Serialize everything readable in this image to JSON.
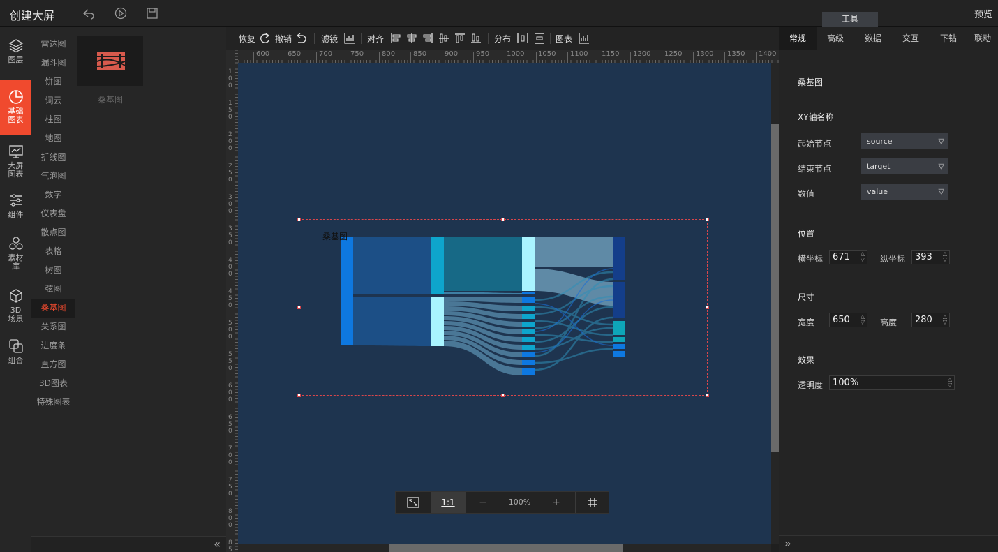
{
  "app": {
    "title": "创建大屏",
    "tools_tab": "工具",
    "preview": "预览",
    "top_icons": [
      "undo-arrow-icon",
      "play-icon",
      "save-icon"
    ]
  },
  "left_nav": [
    {
      "label": "图层",
      "icon": "layers-icon"
    },
    {
      "label": "基础图表",
      "icon": "pie-clock-icon",
      "active": true
    },
    {
      "label": "大屏图表",
      "icon": "screen-chart-icon"
    },
    {
      "label": "组件",
      "icon": "sliders-icon"
    },
    {
      "label": "素材库",
      "icon": "hexagons-icon"
    },
    {
      "label": "3D场景",
      "icon": "cube-icon"
    },
    {
      "label": "组合",
      "icon": "group-icon"
    }
  ],
  "chart_categories": [
    "雷达图",
    "漏斗图",
    "饼图",
    "词云",
    "柱图",
    "地图",
    "折线图",
    "气泡图",
    "数字",
    "仪表盘",
    "散点图",
    "表格",
    "树图",
    "弦图",
    "桑基图",
    "关系图",
    "进度条",
    "直方图",
    "3D图表",
    "特殊图表"
  ],
  "active_category": "桑基图",
  "thumbnail": {
    "label": "桑基图"
  },
  "toolbar": {
    "redo": "恢复",
    "undo": "撤销",
    "filter": "滤镜",
    "align": "对齐",
    "distribute": "分布",
    "chart": "图表"
  },
  "ruler_h": [
    "600",
    "650",
    "700",
    "750",
    "800",
    "850",
    "900",
    "950",
    "1000",
    "1050",
    "1100",
    "1150",
    "1200",
    "1250",
    "1300",
    "1350",
    "1400"
  ],
  "ruler_v": [
    "100",
    "150",
    "200",
    "250",
    "300",
    "350",
    "400",
    "450",
    "500",
    "550",
    "600",
    "650",
    "700",
    "750",
    "800",
    "850",
    "900"
  ],
  "widget": {
    "title": "桑基图"
  },
  "zoom": {
    "fit_icon": "fit-screen-icon",
    "ratio": "1:1",
    "minus": "−",
    "level": "100%",
    "plus": "+",
    "grid_icon": "grid-icon"
  },
  "right_panel": {
    "tabs": [
      "常规",
      "高级",
      "数据",
      "交互",
      "下钻",
      "联动"
    ],
    "active_tab": "常规",
    "chart_name": "桑基图",
    "xy_section": "XY轴名称",
    "fields": [
      {
        "label": "起始节点",
        "value": "source"
      },
      {
        "label": "结束节点",
        "value": "target"
      },
      {
        "label": "数值",
        "value": "value"
      }
    ],
    "position_section": "位置",
    "x_label": "横坐标",
    "x_value": "671",
    "y_label": "纵坐标",
    "y_value": "393",
    "size_section": "尺寸",
    "w_label": "宽度",
    "w_value": "650",
    "h_label": "高度",
    "h_value": "280",
    "effect_section": "效果",
    "opacity_label": "透明度",
    "opacity_value": "100%"
  },
  "colors": {
    "accent": "#f04a2e",
    "canvas_bg": "#1e344f",
    "node_blue": "#0e78e0",
    "node_cyan": "#0ea5cc",
    "node_light": "#a9f4ff",
    "node_dark": "#143e8a",
    "link": "#5b8bb0"
  }
}
